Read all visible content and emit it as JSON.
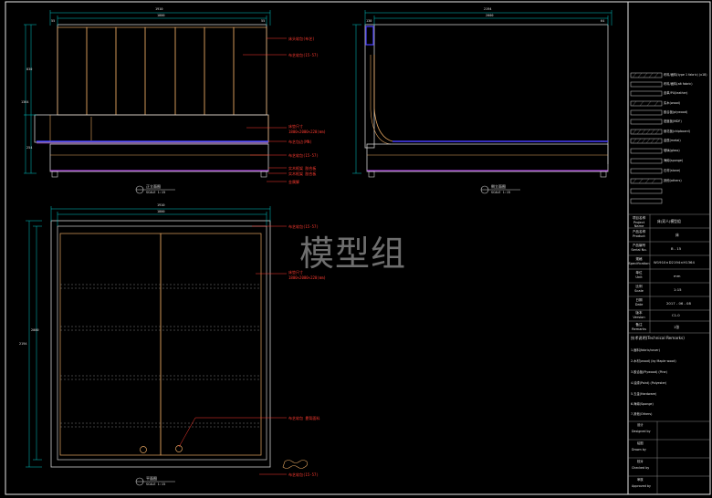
{
  "watermark": "模型组",
  "views": {
    "front": {
      "caption": "正立面图",
      "scale": "SCALE 1:15"
    },
    "side": {
      "caption": "侧立面图",
      "scale": "SCALE 1:15"
    },
    "plan": {
      "caption": "平面图",
      "scale": "SCALE 1:15"
    }
  },
  "dimensions": {
    "front_overall": "1910",
    "front_inner": "1800",
    "front_side_1": "55",
    "front_side_2": "55",
    "front_height_upper": "830",
    "front_height_total": "1364",
    "front_height_base": "254",
    "side_overall": "2194",
    "side_inner": "2000",
    "side_left": "130",
    "side_right": "64",
    "plan_overall": "1910",
    "plan_inner": "1800",
    "plan_depth": "2194",
    "plan_inner_depth": "2000"
  },
  "annotations": {
    "front": [
      "床头软包(布艺)",
      "布艺软包(15-57)",
      "床垫尺寸",
      "1800×2000×220(mm)",
      "布艺包边(MN)",
      "布艺软包(15-57)",
      "实木框架 胶合板",
      "实木框架 胶合板",
      "金属脚"
    ],
    "plan": [
      "布艺软包(15-57)",
      "床垫尺寸",
      "1800×2000×220(mm)",
      "布艺软包 靠背面料",
      "布艺软包(15-57)"
    ]
  },
  "materials_legend": [
    "布料/面料(type 1 fabric) (x18)",
    "布料/面料(alt fabric)",
    "皮革/PU(leather)",
    "实木(wood)",
    "胶合板(plywood)",
    "密度板(MDF)",
    "刨花板(chipboard)",
    "金属(metal)",
    "玻璃(glass)",
    "海绵(sponge)",
    "石材(stone)",
    "其他(others)"
  ],
  "title_block": {
    "rows": [
      {
        "label_cn": "项目名称",
        "label_en": "Project Name",
        "value": "床(双人)模型组"
      },
      {
        "label_cn": "产品名称",
        "label_en": "Product",
        "value": "床"
      },
      {
        "label_cn": "产品编号",
        "label_en": "Serial No.",
        "value": "B - 15"
      },
      {
        "label_cn": "规格",
        "label_en": "Specification",
        "value": "W1910×D2194×H1364"
      },
      {
        "label_cn": "单位",
        "label_en": "Unit",
        "value": "mm"
      },
      {
        "label_cn": "比例",
        "label_en": "Scale",
        "value": "1:15"
      },
      {
        "label_cn": "日期",
        "label_en": "Date",
        "value": "2017 - 06 - 08"
      },
      {
        "label_cn": "版本",
        "label_en": "Version",
        "value": "C1.0"
      },
      {
        "label_cn": "备注",
        "label_en": "Remarks",
        "value": "1张"
      }
    ],
    "remarks_title": "技术说明(Technical Remarks)",
    "remarks": [
      "1.面料(fabric/cover)",
      "2.木材(wood) (by Maple wood)",
      "3.胶合板(Plywood) (Pine)",
      "4.油漆(Paint) (Polyester)",
      "5.五金(Hardware)",
      "6.海绵(Sponge)",
      "7.其他(Others)"
    ],
    "signatures": [
      {
        "cn": "设计",
        "en": "Designed by"
      },
      {
        "cn": "绘图",
        "en": "Drawn by"
      },
      {
        "cn": "校对",
        "en": "Checked by"
      },
      {
        "cn": "审核",
        "en": "Approved by"
      }
    ]
  },
  "colors": {
    "background": "#000000",
    "border": "#e8e8e8",
    "outline": "#cfcfcf",
    "wood": "#e4a560",
    "annotation": "#ff3b30",
    "dimension": "#00c8c8",
    "blue_detail": "#4a40ff",
    "purple_detail": "#c040ff"
  }
}
